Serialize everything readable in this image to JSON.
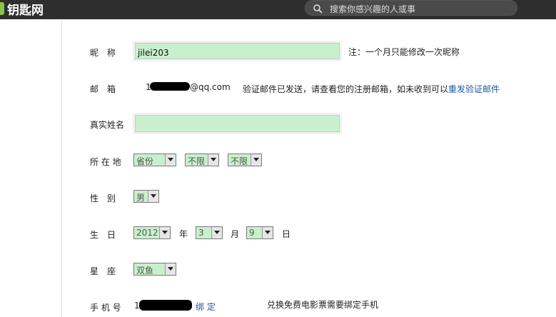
{
  "header": {
    "logo": "钥匙网",
    "search_placeholder": "搜索你感兴趣的人或事"
  },
  "form": {
    "nickname": {
      "label": "昵　称",
      "value": "jilei203",
      "note": "注：一个月只能修改一次昵称"
    },
    "email": {
      "label": "邮　箱",
      "value_visible": "1",
      "value_domain": "@qq.com",
      "note": "验证邮件已发送，请查看您的注册邮箱，如未收到可以",
      "resend_link": "重发验证邮件"
    },
    "realname": {
      "label": "真实姓名",
      "value": ""
    },
    "location": {
      "label": "所 在 地",
      "province": "省份",
      "city": "不限",
      "district": "不限"
    },
    "gender": {
      "label": "性　别",
      "value": "男"
    },
    "birthday": {
      "label": "生　日",
      "year": "2012",
      "year_unit": "年",
      "month": "3",
      "month_unit": "月",
      "day": "9",
      "day_unit": "日"
    },
    "zodiac": {
      "label": "星　座",
      "value": "双鱼"
    },
    "mobile": {
      "label": "手 机 号",
      "value_visible": "1",
      "bind_link": "绑 定",
      "note": "兑换免费电影票需要绑定手机"
    }
  }
}
